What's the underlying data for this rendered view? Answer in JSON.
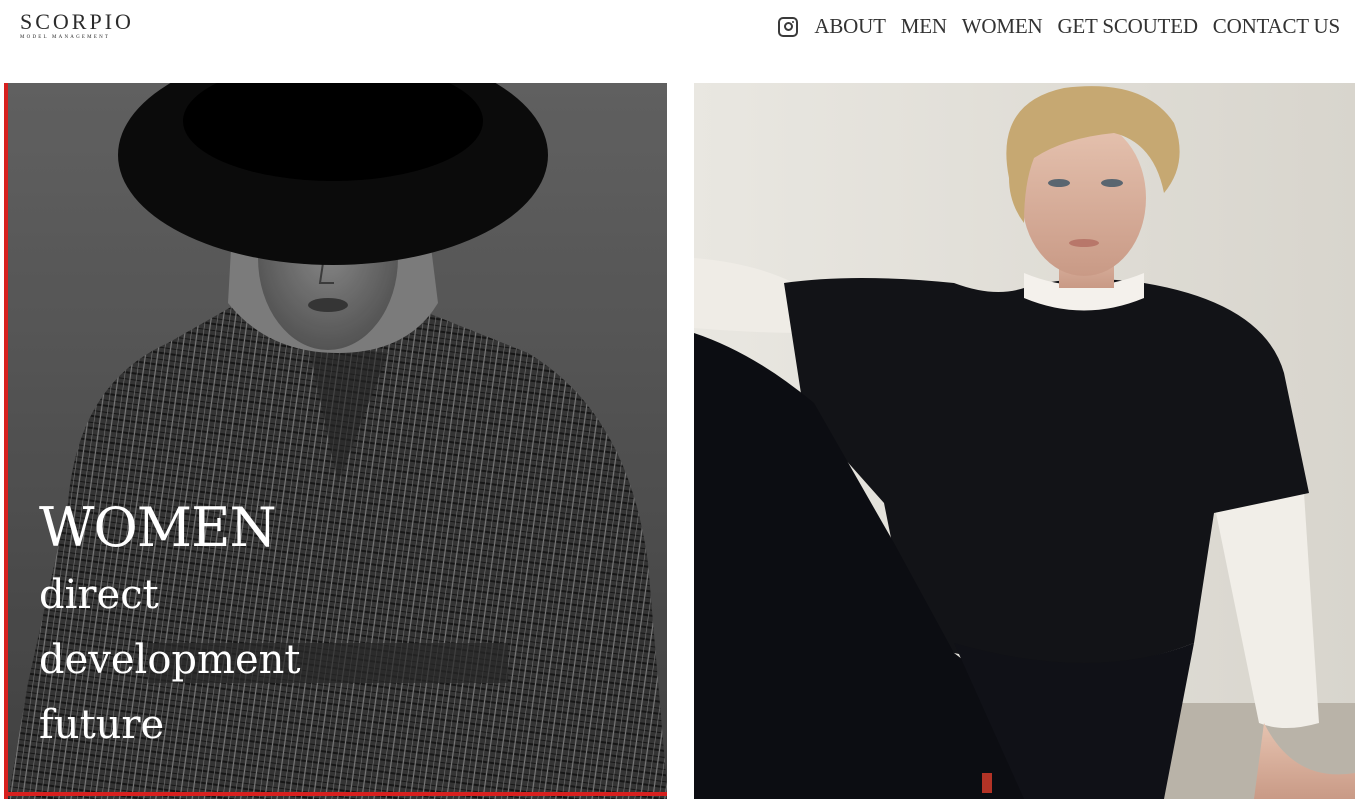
{
  "brand": {
    "name": "SCORPIO",
    "tagline": "MODEL MANAGEMENT"
  },
  "nav": {
    "instagram_icon": "instagram-icon",
    "items": [
      {
        "label": "ABOUT"
      },
      {
        "label": "MEN"
      },
      {
        "label": "WOMEN"
      },
      {
        "label": "GET SCOUTED"
      },
      {
        "label": "CONTACT US"
      }
    ]
  },
  "tiles": {
    "women": {
      "heading": "WOMEN",
      "lines": [
        "direct",
        "development",
        "future"
      ],
      "accent_color": "#d7201e"
    },
    "men": {}
  },
  "colors": {
    "nav_text": "#333333",
    "background": "#ffffff",
    "accent": "#d7201e"
  }
}
